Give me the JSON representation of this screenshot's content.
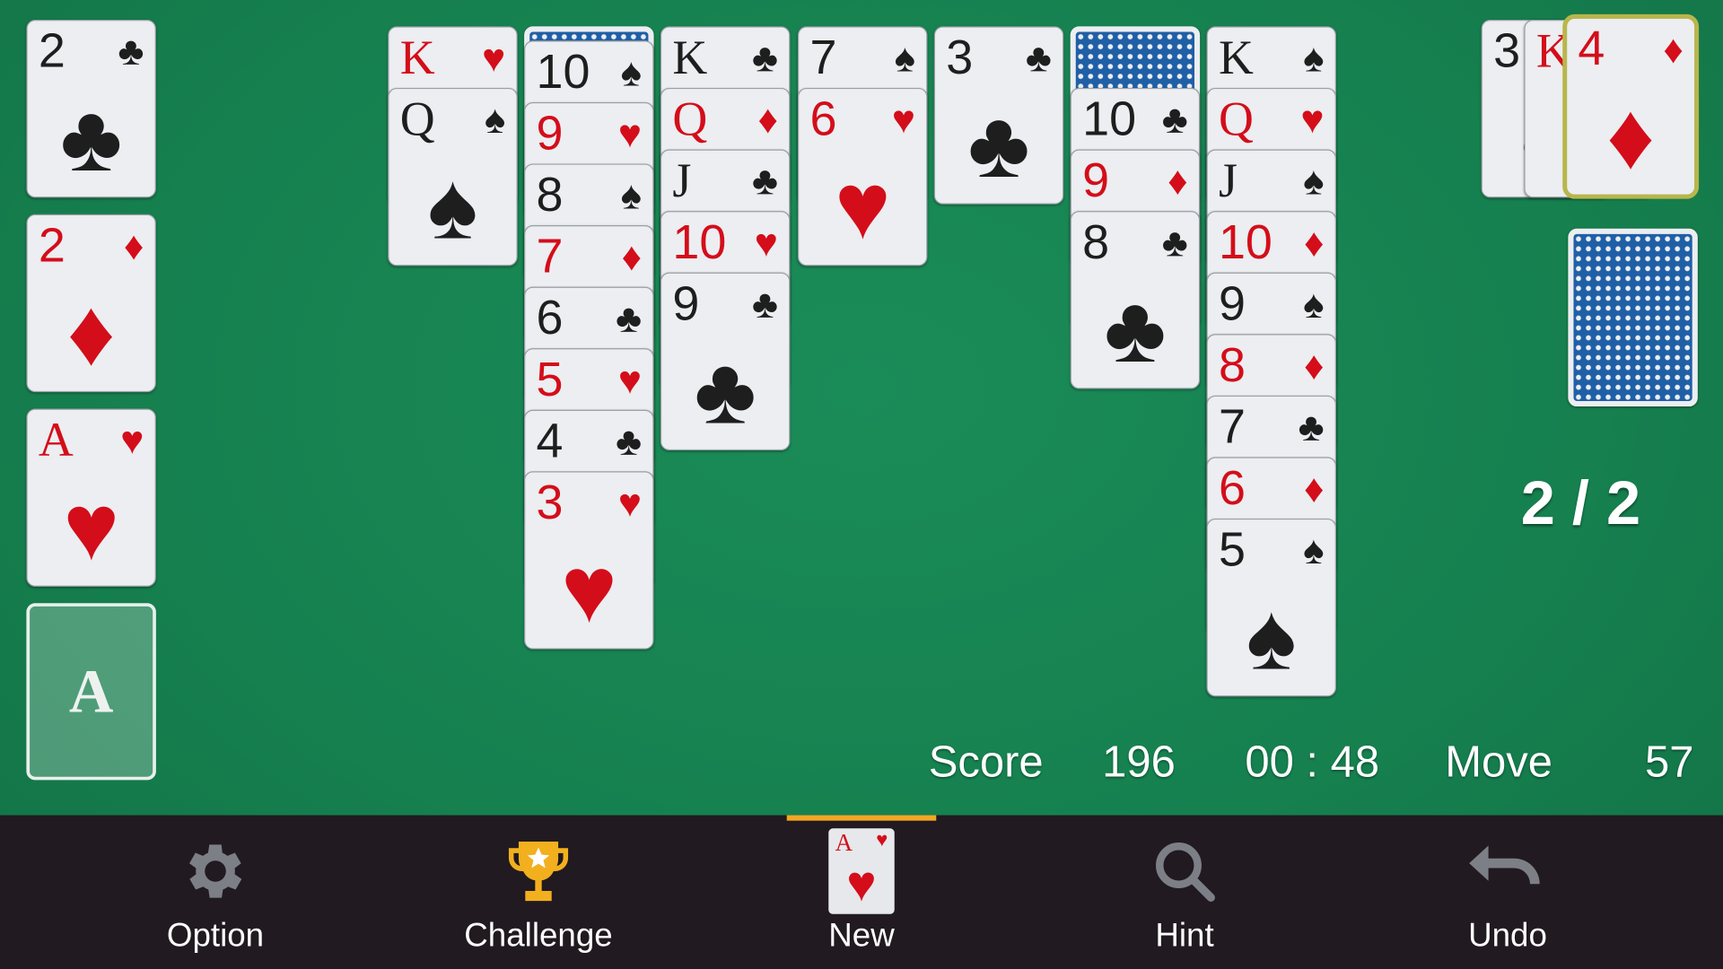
{
  "colors": {
    "felt": "#17804f",
    "bar": "#211a20",
    "accent": "#f2a623",
    "red": "#d40d1a",
    "black": "#1e1e1e",
    "card_back": "#1f5fa6"
  },
  "foundations": [
    {
      "rank": "2",
      "suit": "♣"
    },
    {
      "rank": "2",
      "suit": "♦"
    },
    {
      "rank": "A",
      "suit": "♥"
    },
    {
      "empty": true,
      "label": "A"
    }
  ],
  "tableau": [
    {
      "facedown": 0,
      "cards": [
        {
          "rank": "K",
          "suit": "♥"
        },
        {
          "rank": "Q",
          "suit": "♠"
        }
      ]
    },
    {
      "facedown": 1,
      "cards": [
        {
          "rank": "10",
          "suit": "♠"
        },
        {
          "rank": "9",
          "suit": "♥"
        },
        {
          "rank": "8",
          "suit": "♠"
        },
        {
          "rank": "7",
          "suit": "♦"
        },
        {
          "rank": "6",
          "suit": "♣"
        },
        {
          "rank": "5",
          "suit": "♥"
        },
        {
          "rank": "4",
          "suit": "♣"
        },
        {
          "rank": "3",
          "suit": "♥"
        }
      ]
    },
    {
      "facedown": 0,
      "cards": [
        {
          "rank": "K",
          "suit": "♣"
        },
        {
          "rank": "Q",
          "suit": "♦"
        },
        {
          "rank": "J",
          "suit": "♣"
        },
        {
          "rank": "10",
          "suit": "♥"
        },
        {
          "rank": "9",
          "suit": "♣"
        }
      ]
    },
    {
      "facedown": 0,
      "cards": [
        {
          "rank": "7",
          "suit": "♠"
        },
        {
          "rank": "6",
          "suit": "♥"
        }
      ]
    },
    {
      "facedown": 0,
      "cards": [
        {
          "rank": "3",
          "suit": "♣"
        }
      ]
    },
    {
      "facedown": 1,
      "cards": [
        {
          "rank": "10",
          "suit": "♣"
        },
        {
          "rank": "9",
          "suit": "♦"
        },
        {
          "rank": "8",
          "suit": "♣"
        }
      ]
    },
    {
      "facedown": 0,
      "cards": [
        {
          "rank": "K",
          "suit": "♠"
        },
        {
          "rank": "Q",
          "suit": "♥"
        },
        {
          "rank": "J",
          "suit": "♠"
        },
        {
          "rank": "10",
          "suit": "♦"
        },
        {
          "rank": "9",
          "suit": "♠"
        },
        {
          "rank": "8",
          "suit": "♦"
        },
        {
          "rank": "7",
          "suit": "♣"
        },
        {
          "rank": "6",
          "suit": "♦"
        },
        {
          "rank": "5",
          "suit": "♠"
        }
      ]
    }
  ],
  "waste": [
    {
      "rank": "3",
      "suit": "♠"
    },
    {
      "rank": "K",
      "suit": "♦"
    },
    {
      "rank": "4",
      "suit": "♦",
      "selected": true
    }
  ],
  "stock": {
    "counter": "2 / 2"
  },
  "status": {
    "score_label": "Score",
    "score": "196",
    "time": "00 : 48",
    "move_label": "Move",
    "moves": "57"
  },
  "nav": [
    {
      "label": "Option",
      "icon": "gear-icon"
    },
    {
      "label": "Challenge",
      "icon": "trophy-icon"
    },
    {
      "label": "New",
      "icon": "new-game-card-icon",
      "active": true
    },
    {
      "label": "Hint",
      "icon": "magnifier-icon"
    },
    {
      "label": "Undo",
      "icon": "undo-icon"
    }
  ]
}
